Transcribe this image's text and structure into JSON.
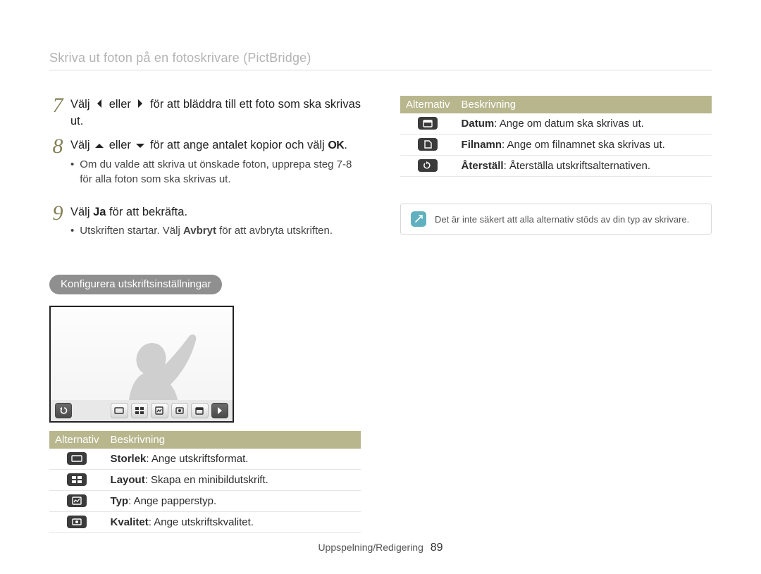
{
  "header": {
    "title": "Skriva ut foton på en fotoskrivare (PictBridge)"
  },
  "steps": [
    {
      "num": "7",
      "prefix": "Välj ",
      "icon1": "chevron-left",
      "mid": " eller ",
      "icon2": "chevron-right",
      "suffix": " för att bläddra till ett foto som ska skrivas ut.",
      "bullets": []
    },
    {
      "num": "8",
      "prefix": "Välj ",
      "icon1": "chevron-up",
      "mid": " eller ",
      "icon2": "chevron-down",
      "suffix": " för att ange antalet kopior och välj ",
      "ok": "OK",
      "tail": ".",
      "bullets": [
        "Om du valde att skriva ut önskade foton, upprepa steg 7-8 för alla foton som ska skrivas ut."
      ]
    },
    {
      "num": "9",
      "line_parts": {
        "a": "Välj ",
        "b": "Ja",
        "c": " för att bekräfta."
      },
      "bullets": [
        {
          "a": "Utskriften startar. Välj ",
          "b": "Avbryt",
          "c": " för att avbryta utskriften."
        }
      ]
    }
  ],
  "section_pill": "Konfigurera utskriftsinställningar",
  "left_table": {
    "headers": [
      "Alternativ",
      "Beskrivning"
    ],
    "rows": [
      {
        "icon": "size-icon",
        "term": "Storlek",
        "desc": ": Ange utskriftsformat."
      },
      {
        "icon": "layout-icon",
        "term": "Layout",
        "desc": ": Skapa en minibildutskrift."
      },
      {
        "icon": "type-icon",
        "term": "Typ",
        "desc": ": Ange papperstyp."
      },
      {
        "icon": "quality-icon",
        "term": "Kvalitet",
        "desc": ": Ange utskriftskvalitet."
      }
    ]
  },
  "right_table": {
    "headers": [
      "Alternativ",
      "Beskrivning"
    ],
    "rows": [
      {
        "icon": "date-icon",
        "term": "Datum",
        "desc": ": Ange om datum ska skrivas ut."
      },
      {
        "icon": "filename-icon",
        "term": "Filnamn",
        "desc": ": Ange om filnamnet ska skrivas ut."
      },
      {
        "icon": "reset-icon",
        "term": "Återställ",
        "desc": ": Återställa utskriftsalternativen."
      }
    ]
  },
  "note": "Det är inte säkert att alla alternativ stöds av din typ av skrivare.",
  "footer": {
    "section": "Uppspelning/Redigering",
    "page": "89"
  }
}
